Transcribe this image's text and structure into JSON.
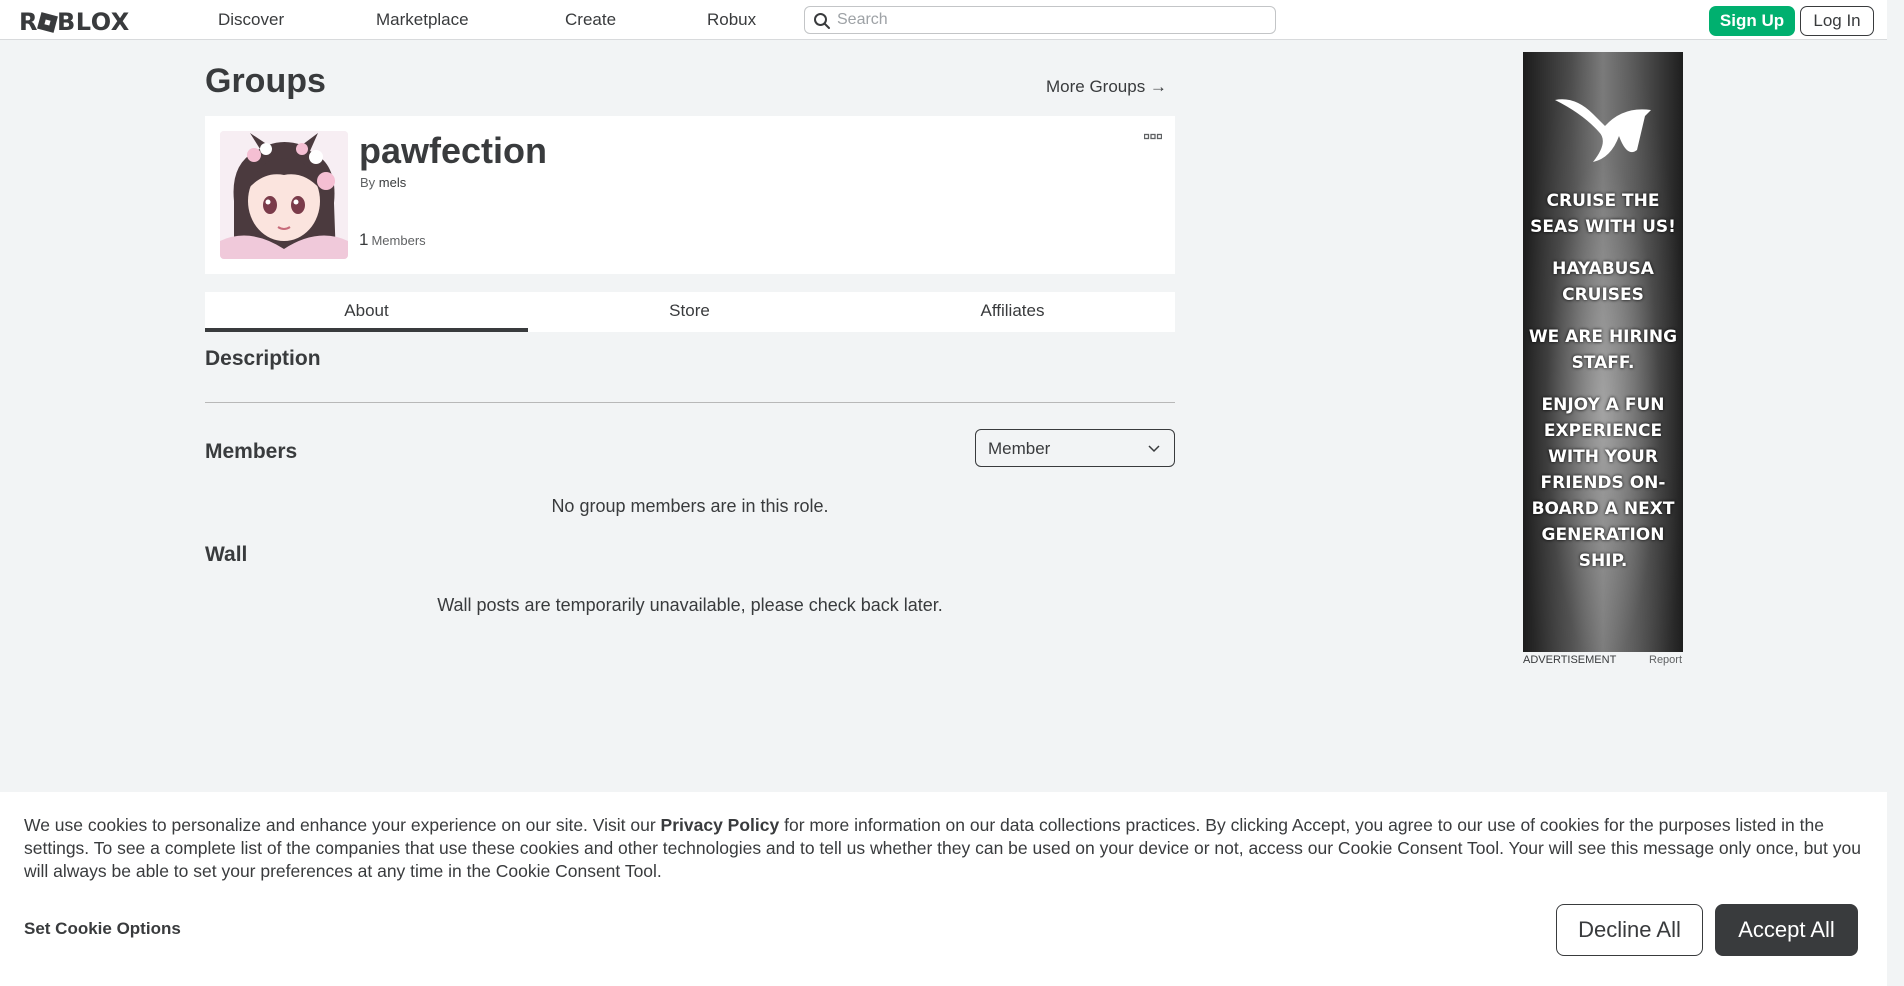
{
  "header": {
    "logo": "ROBLOX",
    "nav": [
      "Discover",
      "Marketplace",
      "Create",
      "Robux"
    ],
    "search_placeholder": "Search",
    "signup_label": "Sign Up",
    "login_label": "Log In"
  },
  "page": {
    "title": "Groups",
    "more_groups": "More Groups →"
  },
  "group": {
    "name": "pawfection",
    "by_prefix": "By",
    "owner": "mels",
    "member_count": "1",
    "member_label": "Members"
  },
  "tabs": [
    {
      "label": "About",
      "active": true
    },
    {
      "label": "Store",
      "active": false
    },
    {
      "label": "Affiliates",
      "active": false
    }
  ],
  "sections": {
    "description": "Description",
    "members": "Members",
    "role_selected": "Member",
    "members_empty": "No group members are in this role.",
    "wall": "Wall",
    "wall_empty": "Wall posts are temporarily unavailable, please check back later."
  },
  "ad": {
    "lines": [
      "CRUISE THE SEAS WITH US!",
      "HAYABUSA CRUISES",
      "WE ARE HIRING STAFF.",
      "ENJOY A FUN EXPERIENCE WITH YOUR FRIENDS ON-BOARD A NEXT GENERATION SHIP."
    ],
    "label": "ADVERTISEMENT",
    "report": "Report"
  },
  "cookie": {
    "text_before": "We use cookies to personalize and enhance your experience on our site. Visit our ",
    "policy_link": "Privacy Policy",
    "text_after": " for more information on our data collections practices. By clicking Accept, you agree to our use of cookies for the purposes listed in the settings. To see a complete list of the companies that use these cookies and other technologies and to tell us whether they can be used on your device or not, access our Cookie Consent Tool. Your will see this message only once, but you will always be able to set your preferences at any time in the Cookie Consent Tool.",
    "set_options": "Set Cookie Options",
    "decline": "Decline All",
    "accept": "Accept All"
  },
  "colors": {
    "signup_green": "#00b06f",
    "text_dark": "#393b3d",
    "page_bg": "#f2f4f5"
  }
}
